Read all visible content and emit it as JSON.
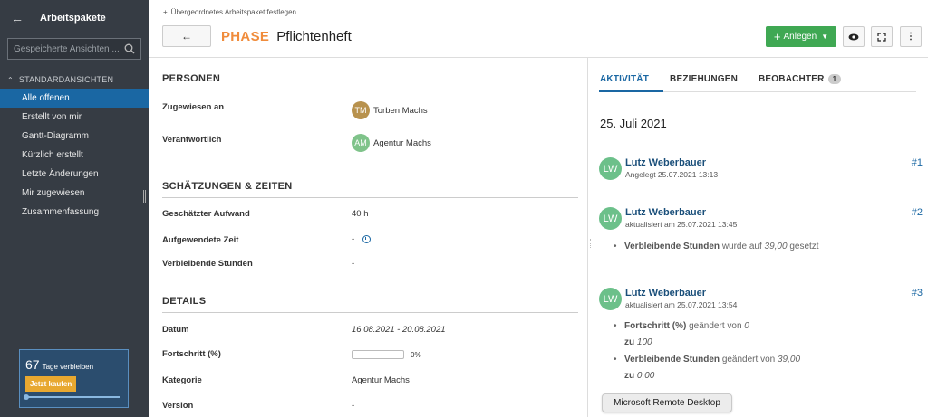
{
  "sidebar": {
    "title": "Arbeitspakete",
    "search_placeholder": "Gespeicherte Ansichten ...",
    "section_label": "STANDARDANSICHTEN",
    "items": [
      {
        "label": "Alle offenen"
      },
      {
        "label": "Erstellt von mir"
      },
      {
        "label": "Gantt-Diagramm"
      },
      {
        "label": "Kürzlich erstellt"
      },
      {
        "label": "Letzte Änderungen"
      },
      {
        "label": "Mir zugewiesen"
      },
      {
        "label": "Zusammenfassung"
      }
    ],
    "trial": {
      "days": "67",
      "text": "Tage verbleiben",
      "button": "Jetzt kaufen"
    }
  },
  "header": {
    "parent_link": "Übergeordnetes Arbeitspaket festlegen",
    "type": "PHASE",
    "subject": "Pflichtenheft",
    "create_label": "Anlegen"
  },
  "details": {
    "people_title": "PERSONEN",
    "assignee_label": "Zugewiesen an",
    "assignee_initials": "TM",
    "assignee_name": "Torben Machs",
    "responsible_label": "Verantwortlich",
    "responsible_initials": "AM",
    "responsible_name": "Agentur Machs",
    "estimates_title": "SCHÄTZUNGEN & ZEITEN",
    "estimated_label": "Geschätzter Aufwand",
    "estimated_value": "40 h",
    "spent_label": "Aufgewendete Zeit",
    "spent_value": "-",
    "remaining_label": "Verbleibende Stunden",
    "remaining_value": "-",
    "details_title": "DETAILS",
    "date_label": "Datum",
    "date_value": "16.08.2021 - 20.08.2021",
    "progress_label": "Fortschritt (%)",
    "progress_value": "0%",
    "progress_fraction": 0,
    "category_label": "Kategorie",
    "category_value": "Agentur Machs",
    "version_label": "Version",
    "version_value": "-"
  },
  "activity": {
    "tabs": [
      {
        "label": "AKTIVITÄT"
      },
      {
        "label": "BEZIEHUNGEN"
      },
      {
        "label": "BEOBACHTER",
        "badge": "1"
      }
    ],
    "date": "25. Juli 2021",
    "entries": [
      {
        "initials": "LW",
        "user": "Lutz Weberbauer",
        "meta": "Angelegt 25.07.2021 13:13",
        "num": "#1"
      },
      {
        "initials": "LW",
        "user": "Lutz Weberbauer",
        "meta": "aktualisiert am 25.07.2021 13:45",
        "num": "#2",
        "changes": [
          {
            "field": "Verbleibende Stunden",
            "text": "wurde auf",
            "value": "39,00",
            "suffix": "gesetzt"
          }
        ]
      },
      {
        "initials": "LW",
        "user": "Lutz Weberbauer",
        "meta": "aktualisiert am 25.07.2021 13:54",
        "num": "#3",
        "changes": [
          {
            "field": "Fortschritt (%)",
            "text": "geändert von",
            "from": "0",
            "to_word": "zu",
            "to": "100"
          },
          {
            "field": "Verbleibende Stunden",
            "text": "geändert von",
            "from": "39,00",
            "to_word": "zu",
            "to": "0,00"
          }
        ]
      }
    ]
  },
  "tooltip": "Microsoft Remote Desktop",
  "colors": {
    "sidebar_bg": "#363c44",
    "accent": "#1a67a3",
    "type_orange": "#f08c3c",
    "create_green": "#3fa853"
  }
}
